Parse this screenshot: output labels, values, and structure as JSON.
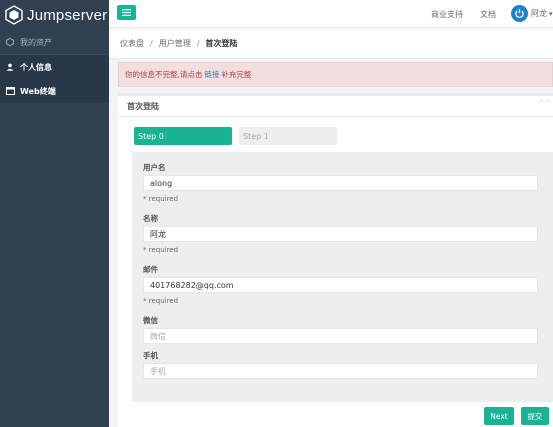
{
  "app": {
    "logo_text": "Jumpserver"
  },
  "sidebar": {
    "section_label": "我的资产",
    "items": [
      {
        "label": "个人信息"
      },
      {
        "label": "Web终端"
      }
    ]
  },
  "topbar": {
    "links": [
      "商业支持",
      "文档"
    ],
    "user_name": "阿龙"
  },
  "breadcrumb": {
    "items": [
      "仪表盘",
      "用户管理"
    ],
    "current": "首次登陆"
  },
  "alert": {
    "text_before": "你的信息不完整,请点击",
    "link_text": "链接",
    "text_after": "补充完整"
  },
  "panel": {
    "title": "首次登陆",
    "steps": [
      {
        "label": "Step 0",
        "active": true
      },
      {
        "label": "Step 1",
        "active": false
      }
    ],
    "fields": [
      {
        "label": "用户名",
        "value": "along",
        "hint": "* required"
      },
      {
        "label": "名称",
        "value": "阿龙",
        "hint": "* required"
      },
      {
        "label": "邮件",
        "value": "401768282@qq.com",
        "hint": "* required"
      },
      {
        "label": "微信",
        "placeholder": "微信"
      },
      {
        "label": "手机",
        "placeholder": "手机"
      }
    ],
    "buttons": {
      "next": "Next",
      "submit": "提交"
    }
  },
  "colors": {
    "sidebar_bg": "#2f4050",
    "accent": "#1ab394",
    "alert_bg": "#f2dede",
    "alert_text": "#a94442"
  }
}
